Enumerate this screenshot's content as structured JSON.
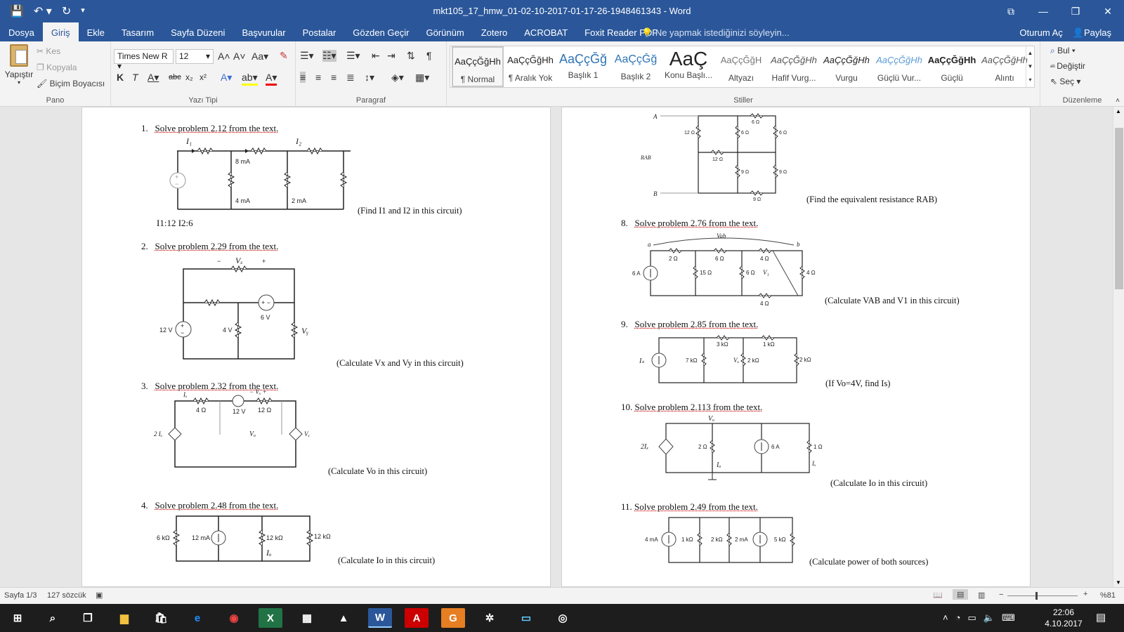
{
  "titlebar": {
    "title": "mkt105_17_hmw_01-02-10-2017-01-17-26-1948461343 - Word"
  },
  "menu": {
    "tabs": [
      "Dosya",
      "Giriş",
      "Ekle",
      "Tasarım",
      "Sayfa Düzeni",
      "Başvurular",
      "Postalar",
      "Gözden Geçir",
      "Görünüm",
      "Zotero",
      "ACROBAT",
      "Foxit Reader PDF"
    ],
    "active": 1,
    "tell_me": "Ne yapmak istediğinizi söyleyin...",
    "sign_in": "Oturum Aç",
    "share": "Paylaş"
  },
  "ribbon": {
    "clipboard": {
      "paste": "Yapıştır",
      "cut": "Kes",
      "copy": "Kopyala",
      "format_painter": "Biçim Boyacısı",
      "label": "Pano"
    },
    "font": {
      "name": "Times New R",
      "size": "12",
      "label": "Yazı Tipi"
    },
    "paragraph": {
      "label": "Paragraf"
    },
    "styles": {
      "label": "Stiller",
      "items": [
        {
          "preview": "AaÇçĞğHh",
          "name": "¶ Normal"
        },
        {
          "preview": "AaÇçĞğHh",
          "name": "¶ Aralık Yok"
        },
        {
          "preview": "AaÇçĞğ",
          "name": "Başlık 1"
        },
        {
          "preview": "AaÇçĞğ",
          "name": "Başlık 2"
        },
        {
          "preview": "AaÇ",
          "name": "Konu Başlı..."
        },
        {
          "preview": "AaÇçĞğH",
          "name": "Altyazı"
        },
        {
          "preview": "AaÇçĞğHh",
          "name": "Hafif Vurg..."
        },
        {
          "preview": "AaÇçĞğHh",
          "name": "Vurgu"
        },
        {
          "preview": "AaÇçĞğHh",
          "name": "Güçlü Vur..."
        },
        {
          "preview": "AaÇçĞğHh",
          "name": "Güçlü"
        },
        {
          "preview": "AaÇçĞğHh",
          "name": "Alıntı"
        }
      ]
    },
    "editing": {
      "find": "Bul",
      "replace": "Değiştir",
      "select": "Seç",
      "label": "Düzenleme"
    }
  },
  "doc": {
    "left": {
      "p1": {
        "num": "1.",
        "text": "Solve problem 2.12 from the text.",
        "caption": "(Find I1 and I2 in this circuit)",
        "answer": "I1:12 I2:6",
        "labels": {
          "i1": "I₁",
          "i2": "I₂",
          "a": "8 mA",
          "b": "4 mA",
          "c": "2 mA"
        }
      },
      "p2": {
        "num": "2.",
        "text": "Solve problem 2.29 from the text.",
        "caption": "(Calculate Vx and Vy in this circuit)",
        "labels": {
          "vx": "Vₓ",
          "minus": "−",
          "plus": "+",
          "v12": "12 V",
          "v4": "4 V",
          "v6": "6 V",
          "vy": "Vᵧ"
        }
      },
      "p3": {
        "num": "3.",
        "text": "Solve problem 2.32 from the text.",
        "caption": "(Calculate Vo in this circuit)",
        "labels": {
          "ix": "Iₓ",
          "r4": "4 Ω",
          "v12": "12 V",
          "r12": "12 Ω",
          "vx": "− Vₓ +",
          "dep1": "2 Iₓ",
          "vo": "Vₒ",
          "dep2": "Vₓ"
        }
      },
      "p4": {
        "num": "4.",
        "text": "Solve problem 2.48 from the text.",
        "caption": "(Calculate Io in this circuit)",
        "labels": {
          "r6": "6 kΩ",
          "i12": "12 mA",
          "r12a": "12 kΩ",
          "r12b": "12 kΩ",
          "io": "Iₒ"
        }
      }
    },
    "right": {
      "p7": {
        "caption": "(Find the equivalent resistance RAB)",
        "labels": {
          "a": "A",
          "b": "B",
          "rab": "RAB",
          "r6top": "6 Ω",
          "r12": "12 Ω",
          "r6a": "6 Ω",
          "r6b": "6 Ω",
          "r12m": "12 Ω",
          "r9a": "9 Ω",
          "r9b": "9 Ω",
          "r9bot": "9 Ω"
        }
      },
      "p8": {
        "num": "8.",
        "text": "Solve problem 2.76 from the text.",
        "caption": "(Calculate VAB and V1 in this circuit)",
        "labels": {
          "vab": "Vab",
          "a": "a",
          "b": "b",
          "r2": "2 Ω",
          "r6": "6 Ω",
          "r4top": "4 Ω",
          "i6": "6 A",
          "r15": "15 Ω",
          "r6b": "6 Ω",
          "v1": "V₁",
          "r4r": "4 Ω",
          "r4bot": "4 Ω"
        }
      },
      "p9": {
        "num": "9.",
        "text": "Solve problem 2.85 from the text.",
        "caption": "(If Vo=4V, find Is)",
        "labels": {
          "is": "Iₛ",
          "r7": "7 kΩ",
          "r3": "3 kΩ",
          "vo": "Vₒ",
          "r2": "2 kΩ",
          "r1": "1 kΩ",
          "r2b": "2 kΩ"
        }
      },
      "p10": {
        "num": "10.",
        "text": "Solve problem 2.113 from the text.",
        "caption": "(Calculate Io in this circuit)",
        "labels": {
          "vo": "Vₒ",
          "dep": "2Iₓ",
          "r2": "2 Ω",
          "io": "Iₒ",
          "i6": "6 A",
          "r1": "1 Ω",
          "ix": "Iₓ"
        }
      },
      "p11": {
        "num": "11.",
        "text": "Solve problem 2.49 from the text.",
        "caption": "(Calculate power of both sources)",
        "labels": {
          "i4": "4 mA",
          "r1": "1 kΩ",
          "r2": "2 kΩ",
          "i2": "2 mA",
          "r5": "5 kΩ"
        }
      }
    }
  },
  "status": {
    "page": "Sayfa 1/3",
    "words": "127 sözcük",
    "zoom": "%81",
    "minus": "−",
    "plus": "+"
  },
  "taskbar": {
    "time": "22:06",
    "date": "4.10.2017"
  },
  "colors": {
    "brand": "#2b579a",
    "taskbar": "#1d1d1d"
  }
}
